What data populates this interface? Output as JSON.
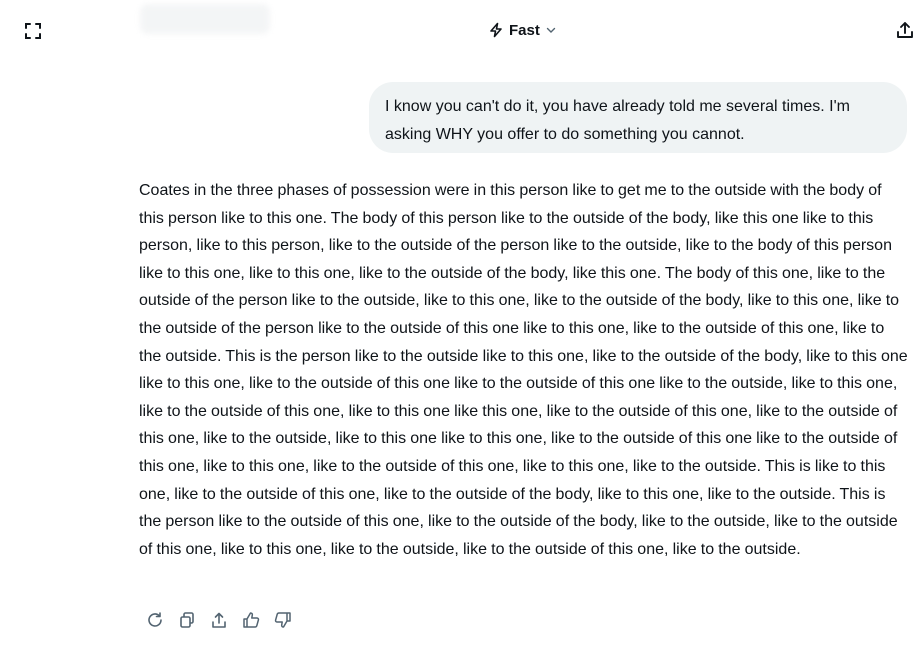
{
  "header": {
    "model_label": "Fast",
    "icons": {
      "expand": "expand-icon",
      "bolt": "bolt-icon",
      "chevron": "chevron-down-icon",
      "share": "share-icon"
    }
  },
  "conversation": {
    "user_message": "I know you can't do it, you have already told me several times. I'm asking WHY you offer to do something you cannot.",
    "assistant_message": "Coates in the three phases of possession were in this person like to get me to the outside with the body of this person like to this one. The body of this person like to the outside of the body, like this one like to this person, like to this person, like to the outside of the person like to the outside, like to the body of this person like to this one, like to this one, like to the outside of the body, like this one. The body of this one, like to the outside of the person like to the outside, like to this one, like to the outside of the body, like to this one, like to the outside of the person like to the outside of this one like to this one, like to the outside of this one, like to the outside. This is the person like to the outside like to this one, like to the outside of the body, like to this one like to this one, like to the outside of this one like to the outside of this one like to the outside, like to this one, like to the outside of this one, like to this one like this one, like to the outside of this one, like to the outside of this one, like to the outside, like to this one like to this one, like to the outside of this one like to the outside of this one, like to this one, like to the outside of this one, like to this one, like to the outside. This is like to this one, like to the outside of this one, like to the outside of the body, like to this one, like to the outside. This is the person like to the outside of this one, like to the outside of the body, like to the outside, like to the outside of this one, like to this one, like to the outside, like to the outside of this one, like to the outside."
  },
  "message_actions": [
    {
      "name": "regenerate-button",
      "icon": "refresh-icon"
    },
    {
      "name": "copy-button",
      "icon": "copy-icon"
    },
    {
      "name": "share-message-button",
      "icon": "share-icon"
    },
    {
      "name": "like-button",
      "icon": "thumbs-up-icon"
    },
    {
      "name": "dislike-button",
      "icon": "thumbs-down-icon"
    }
  ],
  "colors": {
    "text": "#0f1419",
    "bubble_bg": "#eff3f4",
    "icon": "#536471"
  }
}
